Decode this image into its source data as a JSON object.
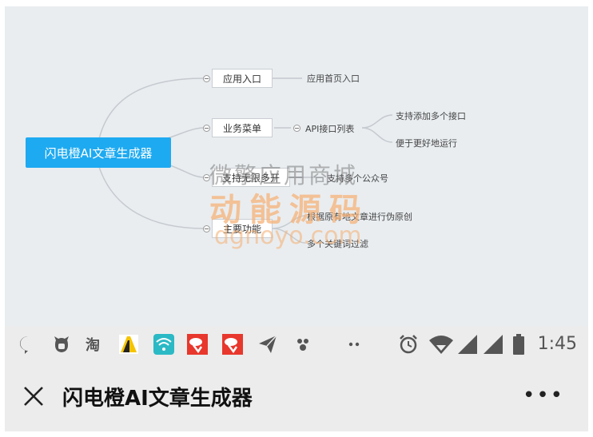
{
  "mindmap": {
    "root": "闪电橙AI文章生成器",
    "branch1": "应用入口",
    "branch1_leaf": "应用首页入口",
    "branch2": "业务菜单",
    "branch2_child": "API接口列表",
    "branch2_leaf1": "支持添加多个接口",
    "branch2_leaf2": "便于更好地运行",
    "branch3": "支持无限多开",
    "branch3_leaf": "支持多个公众号",
    "branch4": "主要功能",
    "branch4_leaf1": "根据原有地文章进行伪原创",
    "branch4_leaf2": "多个关键词过滤",
    "line_color": "#c5cad0",
    "root_color": "#1eaaf1"
  },
  "watermark": {
    "line1": "微擎应用商城",
    "line2": "动能源码",
    "line3": "dgnoyo.com"
  },
  "statusbar": {
    "icons": [
      "message-icon",
      "ghost-icon",
      "taobao-icon",
      "app-a-icon",
      "wifi-app-icon",
      "red-app-icon",
      "red-app-icon",
      "send-icon",
      "pets-icon",
      "dots-icon",
      "alarm-icon",
      "wifi-signal-icon",
      "cell-signal-icon",
      "cell-signal-icon",
      "battery-icon"
    ],
    "time": "1:45"
  },
  "titlebar": {
    "title": "闪电橙AI文章生成器",
    "more_label": "•••"
  }
}
